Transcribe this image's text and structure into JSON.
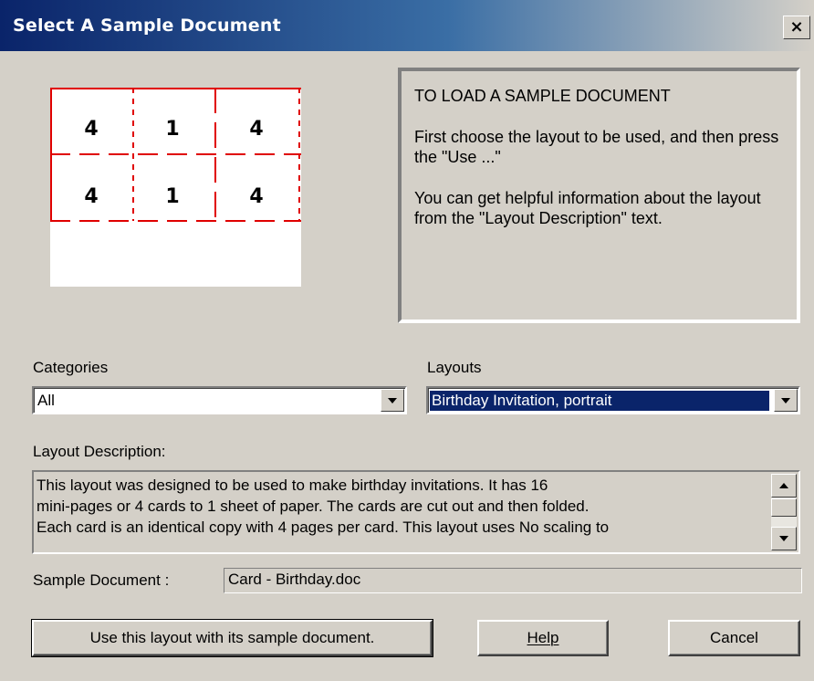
{
  "window": {
    "title": "Select A Sample Document",
    "close_label": "×"
  },
  "preview": {
    "cells_top_row": [
      "4",
      "1",
      "4"
    ],
    "cells_bottom_row": [
      "4",
      "1",
      "4"
    ],
    "line_color": "#e00000"
  },
  "info": {
    "heading": "TO LOAD A SAMPLE DOCUMENT",
    "para1": "First choose the layout to be used, and then press the \"Use ...\"",
    "para2": "You can get helpful information about the layout from the \"Layout Description\" text."
  },
  "categories": {
    "label": "Categories",
    "value": "All"
  },
  "layouts": {
    "label": "Layouts",
    "value": "Birthday Invitation, portrait"
  },
  "description": {
    "label": "Layout Description:",
    "lines": [
      "This layout was designed to be used to make birthday invitations.  It has 16",
      "mini-pages or 4 cards to 1 sheet of paper.  The cards are cut out and then folded.",
      "Each card is an identical copy with 4 pages per card.  This layout uses No scaling to"
    ]
  },
  "sample_document": {
    "label": "Sample Document :",
    "value": "Card - Birthday.doc"
  },
  "buttons": {
    "use_layout": "Use this layout with its sample document.",
    "help": "Help",
    "cancel": "Cancel"
  },
  "colors": {
    "dialog_bg": "#d4d0c8",
    "title_bar_start": "#0a246a",
    "selection": "#0a246a"
  }
}
